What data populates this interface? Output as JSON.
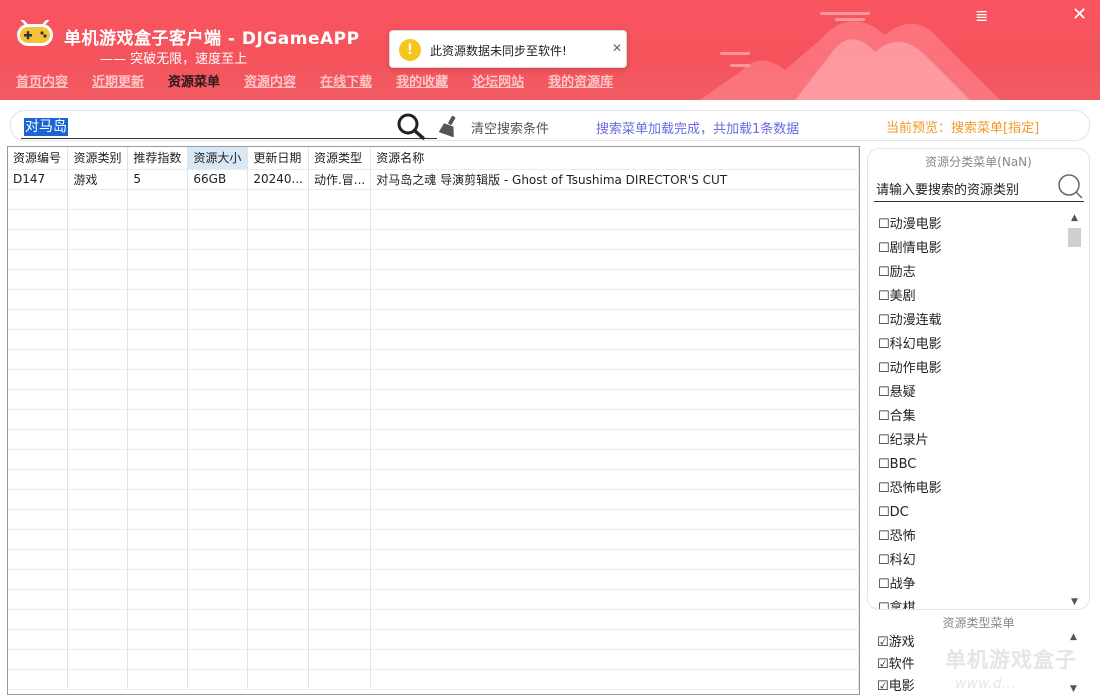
{
  "app": {
    "title": "单机游戏盒子客户端 - DJGameAPP",
    "slogan": "—— 突破无限，速度至上"
  },
  "nav": [
    {
      "label": "首页内容",
      "active": false
    },
    {
      "label": "近期更新",
      "active": false
    },
    {
      "label": "资源菜单",
      "active": true
    },
    {
      "label": "资源内容",
      "active": false
    },
    {
      "label": "在线下载",
      "active": false
    },
    {
      "label": "我的收藏",
      "active": false
    },
    {
      "label": "论坛网站",
      "active": false
    },
    {
      "label": "我的资源库",
      "active": false
    }
  ],
  "window_controls": {
    "menu": "≣",
    "close": "✕"
  },
  "toast": {
    "icon": "!",
    "text": "此资源数据未同步至软件!",
    "close": "✕"
  },
  "search": {
    "value": "对马岛",
    "clear_label": "清空搜索条件",
    "status": "搜索菜单加载完成，共加载1条数据",
    "preview": "当前预览：搜索菜单[指定]"
  },
  "table": {
    "columns": [
      "资源编号",
      "资源类别",
      "推荐指数",
      "资源大小",
      "更新日期",
      "资源类型",
      "资源名称"
    ],
    "sorted_column": 3,
    "rows": [
      [
        "D147",
        "游戏",
        "5",
        "66GB",
        "20240...",
        "动作.冒...",
        "对马岛之魂 导演剪辑版 - Ghost of Tsushima DIRECTOR'S CUT"
      ]
    ]
  },
  "categories": {
    "title": "资源分类菜单(NaN)",
    "search_placeholder": "请输入要搜索的资源类别",
    "items": [
      "☐动漫电影",
      "☐剧情电影",
      "☐励志",
      "☐美剧",
      "☐动漫连载",
      "☐科幻电影",
      "☐动作电影",
      "☐悬疑",
      "☐合集",
      "☐纪录片",
      "☐BBC",
      "☐恐怖电影",
      "☐DC",
      "☐恐怖",
      "☐科幻",
      "☐战争",
      "☐拿棋"
    ]
  },
  "types": {
    "title": "资源类型菜单",
    "items": [
      "☑游戏",
      "☑软件",
      "☑电影"
    ]
  },
  "watermark": {
    "line1": "单机游戏盒子",
    "line2": "www.d..."
  },
  "colors": {
    "header": "#f5535c",
    "accent_blue": "#6a6ae0",
    "accent_orange": "#f29a25",
    "sorted_header": "#d8e8f6"
  }
}
